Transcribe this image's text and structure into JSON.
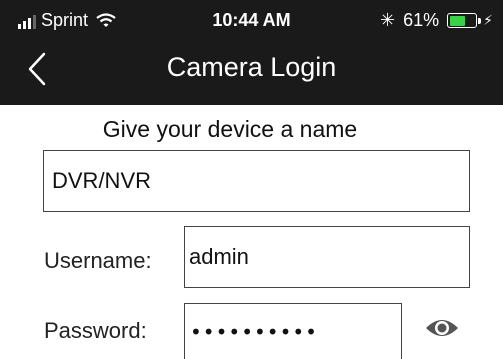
{
  "status_bar": {
    "carrier": "Sprint",
    "time": "10:44 AM",
    "battery_percent": "61%",
    "battery_level": 0.61,
    "battery_color": "#3ad14a",
    "icons": [
      "signal-icon",
      "wifi-icon",
      "bluetooth-icon",
      "battery-icon",
      "charging-icon"
    ]
  },
  "nav": {
    "title": "Camera Login",
    "back_icon": "chevron-left-icon"
  },
  "form": {
    "prompt": "Give your device a name",
    "device_name": "DVR/NVR",
    "username_label": "Username:",
    "username_value": "admin",
    "password_label": "Password:",
    "password_value": "••••••••••",
    "show_password_icon": "eye-icon"
  },
  "colors": {
    "header_bg": "#1a1a1a",
    "page_bg": "#ffffff",
    "eye_icon": "#555555"
  }
}
